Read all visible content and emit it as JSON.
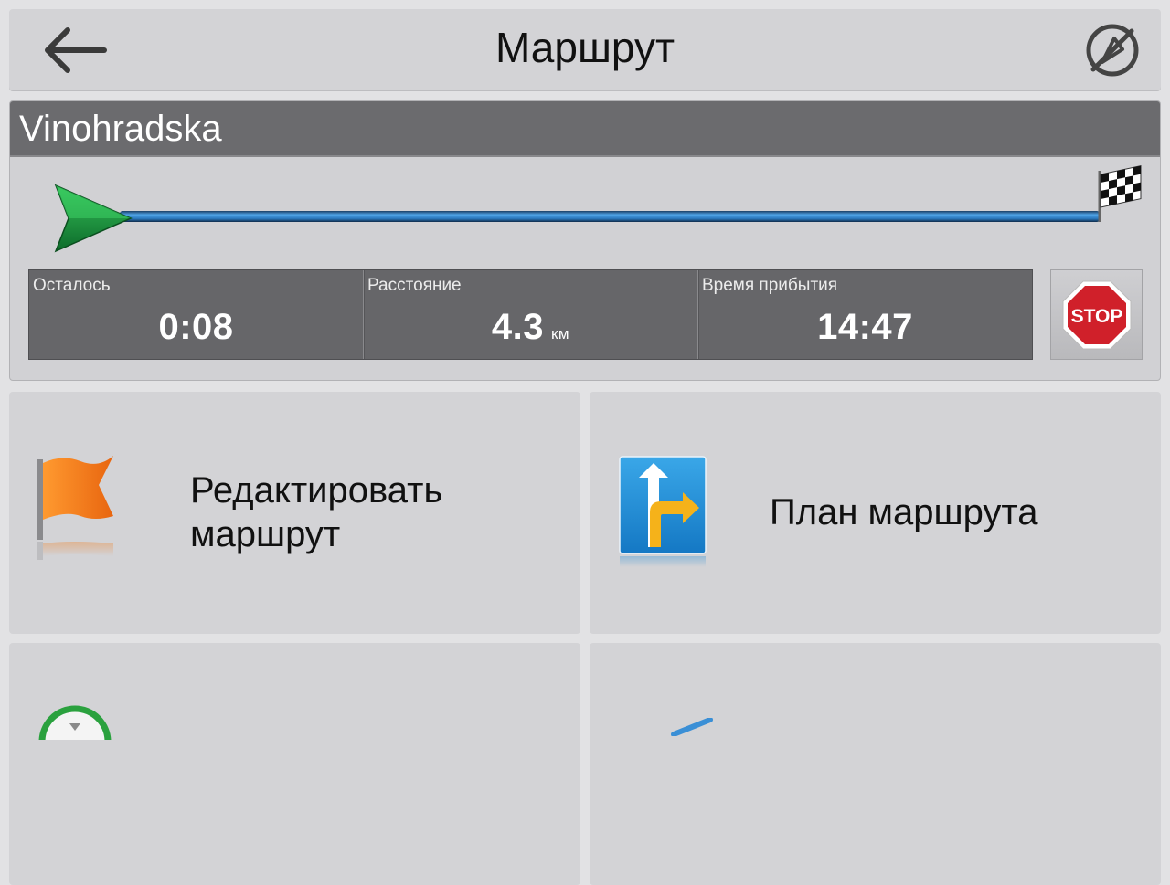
{
  "header": {
    "title": "Маршрут",
    "back_icon": "arrow-left-icon",
    "right_icon": "no-map-icon"
  },
  "route": {
    "street": "Vinohradska",
    "progress": 0.0,
    "start_icon": "green-arrow-icon",
    "finish_icon": "checkered-flag-icon",
    "stats": {
      "remaining_label": "Осталось",
      "remaining_value": "0:08",
      "distance_label": "Расстояние",
      "distance_value": "4.3",
      "distance_unit": "км",
      "arrival_label": "Время прибытия",
      "arrival_value": "14:47"
    },
    "stop_label": "STOP"
  },
  "menu": {
    "edit_route": {
      "line1": "Редактировать",
      "line2": "маршрут",
      "icon": "orange-flag-icon"
    },
    "route_plan": {
      "label": "План маршрута",
      "icon": "route-directions-icon"
    },
    "bottom_left_icon": "green-circle-icon",
    "bottom_right_icon": "blue-arrow-icon"
  },
  "colors": {
    "header_bg": "#d3d3d6",
    "street_bg": "#6b6b6e",
    "stats_bg": "#666669",
    "route_line": "#2e7fc4",
    "start_arrow": "#1f9a3a",
    "stop_red": "#d0202a",
    "flag_orange": "#f07a18"
  }
}
